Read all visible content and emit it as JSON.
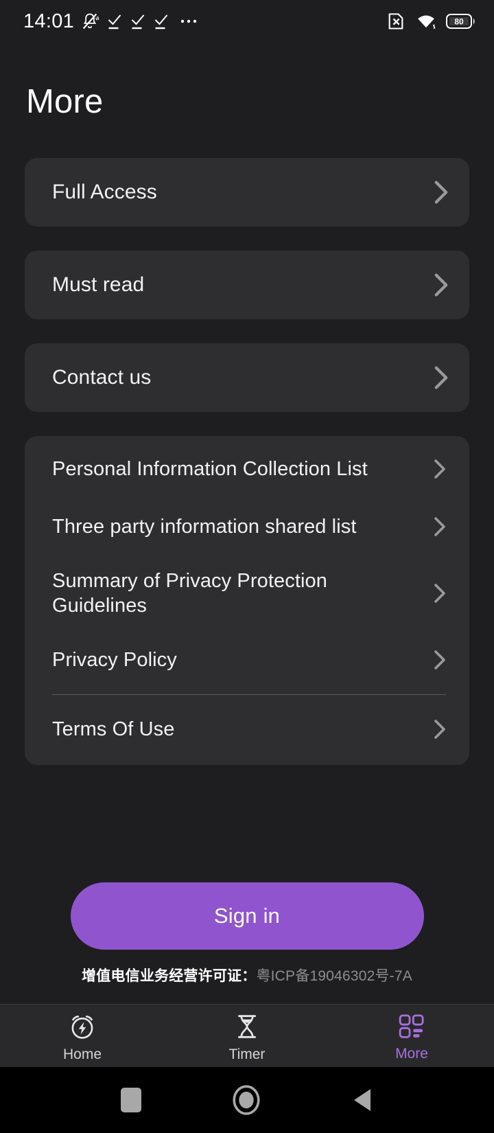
{
  "status_bar": {
    "time": "14:01",
    "left_icons": [
      "bell-muted-icon",
      "check-1-icon",
      "check-2-icon",
      "check-3-icon",
      "overflow-dots-icon"
    ],
    "right_icons": [
      "sim-error-icon",
      "wifi-icon",
      "battery-icon"
    ],
    "battery_level": "80"
  },
  "header": {
    "title": "More"
  },
  "menu": {
    "primary": [
      {
        "label": "Full Access",
        "chevron": "chevron-right-icon"
      },
      {
        "label": "Must read",
        "chevron": "chevron-right-icon"
      },
      {
        "label": "Contact us",
        "chevron": "chevron-right-icon"
      }
    ],
    "legal": [
      {
        "label": "Personal Information Collection List",
        "chevron": "chevron-right-icon"
      },
      {
        "label": "Three party information shared list",
        "chevron": "chevron-right-icon"
      },
      {
        "label": "Summary of Privacy Protection Guidelines",
        "chevron": "chevron-right-icon"
      },
      {
        "label": "Privacy Policy",
        "chevron": "chevron-right-icon"
      },
      {
        "label": "Terms Of Use",
        "chevron": "chevron-right-icon"
      }
    ]
  },
  "auth": {
    "sign_in_label": "Sign in",
    "button_color": "#9055ce"
  },
  "footer": {
    "icp_label": "增值电信业务经营许可证：",
    "icp_value": "粤ICP备19046302号-7A"
  },
  "tab_bar": {
    "active": "More",
    "accent_color": "#a970e0",
    "tabs": [
      {
        "label": "Home",
        "icon": "alarm-bolt-icon",
        "active": false
      },
      {
        "label": "Timer",
        "icon": "hourglass-icon",
        "active": false
      },
      {
        "label": "More",
        "icon": "grid-more-icon",
        "active": true
      }
    ]
  },
  "android_nav": {
    "buttons": [
      {
        "name": "recents-button",
        "icon": "square-icon"
      },
      {
        "name": "home-button",
        "icon": "circle-icon"
      },
      {
        "name": "back-button",
        "icon": "triangle-left-icon"
      }
    ]
  }
}
